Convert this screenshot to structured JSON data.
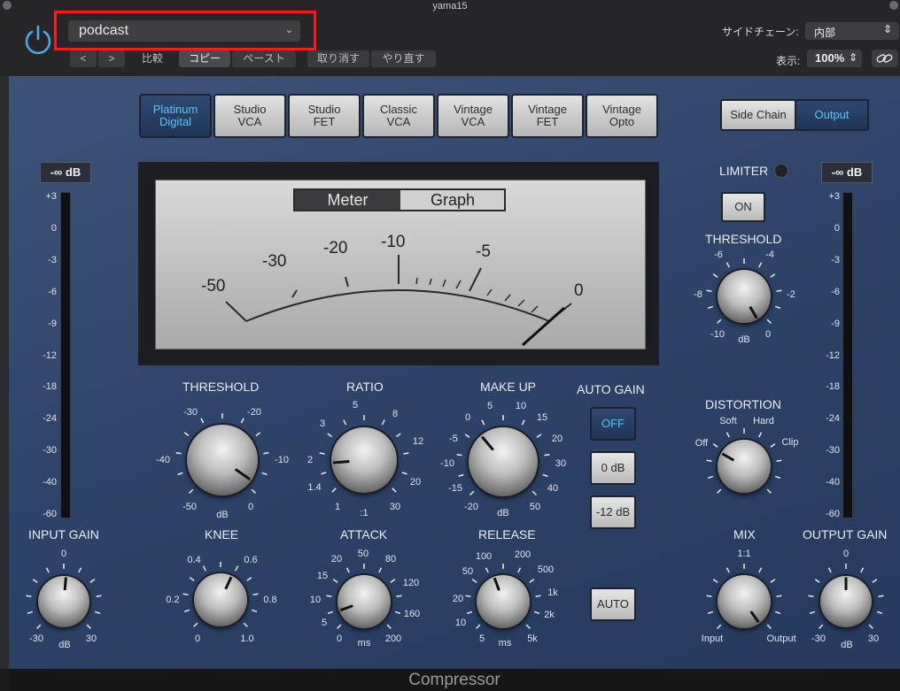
{
  "window": {
    "title": "yama15"
  },
  "header": {
    "preset": "podcast",
    "nav_prev": "<",
    "nav_next": ">",
    "compare": "比較",
    "copy": "コピー",
    "paste": "ペースト",
    "undo": "取り消す",
    "redo": "やり直す",
    "sidechain_label": "サイドチェーン:",
    "sidechain_value": "内部",
    "view_label": "表示:",
    "zoom_value": "100%"
  },
  "models": [
    "Platinum\nDigital",
    "Studio\nVCA",
    "Studio\nFET",
    "Classic\nVCA",
    "Vintage\nVCA",
    "Vintage\nFET",
    "Vintage\nOpto"
  ],
  "routing": {
    "side_chain": "Side Chain",
    "output": "Output"
  },
  "input": {
    "readout": "-∞ dB",
    "label": "INPUT GAIN",
    "scale": [
      "+3",
      "0",
      "-3",
      "-6",
      "-9",
      "-12",
      "-18",
      "-24",
      "-30",
      "-40",
      "-60"
    ],
    "knob_ticks": [
      "0",
      "-30",
      "dB",
      "30"
    ]
  },
  "output": {
    "readout": "-∞ dB",
    "label": "OUTPUT GAIN",
    "scale": [
      "+3",
      "0",
      "-3",
      "-6",
      "-9",
      "-12",
      "-18",
      "-24",
      "-30",
      "-40",
      "-60"
    ],
    "knob_ticks": [
      "0",
      "-30",
      "dB",
      "30"
    ]
  },
  "meter": {
    "tab_meter": "Meter",
    "tab_graph": "Graph",
    "scale": [
      "-50",
      "-30",
      "-20",
      "-10",
      "-5",
      "0"
    ]
  },
  "threshold": {
    "label": "THRESHOLD",
    "ticks": [
      "-30",
      "-20",
      "-40",
      "-10",
      "-50",
      "dB",
      "0"
    ]
  },
  "ratio": {
    "label": "RATIO",
    "ticks": [
      "5",
      "3",
      "8",
      "12",
      "2",
      "1.4",
      "20",
      "1",
      ":1",
      "30"
    ]
  },
  "makeup": {
    "label": "MAKE UP",
    "ticks": [
      "5",
      "10",
      "0",
      "15",
      "-5",
      "20",
      "-10",
      "30",
      "-15",
      "40",
      "-20",
      "dB",
      "50"
    ]
  },
  "autogain": {
    "label": "AUTO GAIN",
    "off": "OFF",
    "zero": "0 dB",
    "minus12": "-12 dB"
  },
  "knee": {
    "label": "KNEE",
    "ticks": [
      "0.4",
      "0.6",
      "0.2",
      "0.8",
      "0",
      "1.0"
    ]
  },
  "attack": {
    "label": "ATTACK",
    "ticks": [
      "20",
      "50",
      "80",
      "15",
      "120",
      "10",
      "160",
      "5",
      "0",
      "ms",
      "200"
    ]
  },
  "release": {
    "label": "RELEASE",
    "ticks": [
      "100",
      "200",
      "50",
      "500",
      "20",
      "1k",
      "10",
      "2k",
      "5",
      "ms",
      "5k"
    ]
  },
  "auto_btn": "AUTO",
  "limiter": {
    "label": "LIMITER",
    "on": "ON",
    "threshold_label": "THRESHOLD",
    "ticks": [
      "-6",
      "-4",
      "-8",
      "-2",
      "-10",
      "dB",
      "0"
    ]
  },
  "distortion": {
    "label": "DISTORTION",
    "ticks": [
      "Soft",
      "Hard",
      "Off",
      "Clip"
    ]
  },
  "mix": {
    "label": "MIX",
    "ticks": [
      "1:1",
      "Input",
      "Output"
    ]
  },
  "footer": {
    "title": "Compressor"
  }
}
